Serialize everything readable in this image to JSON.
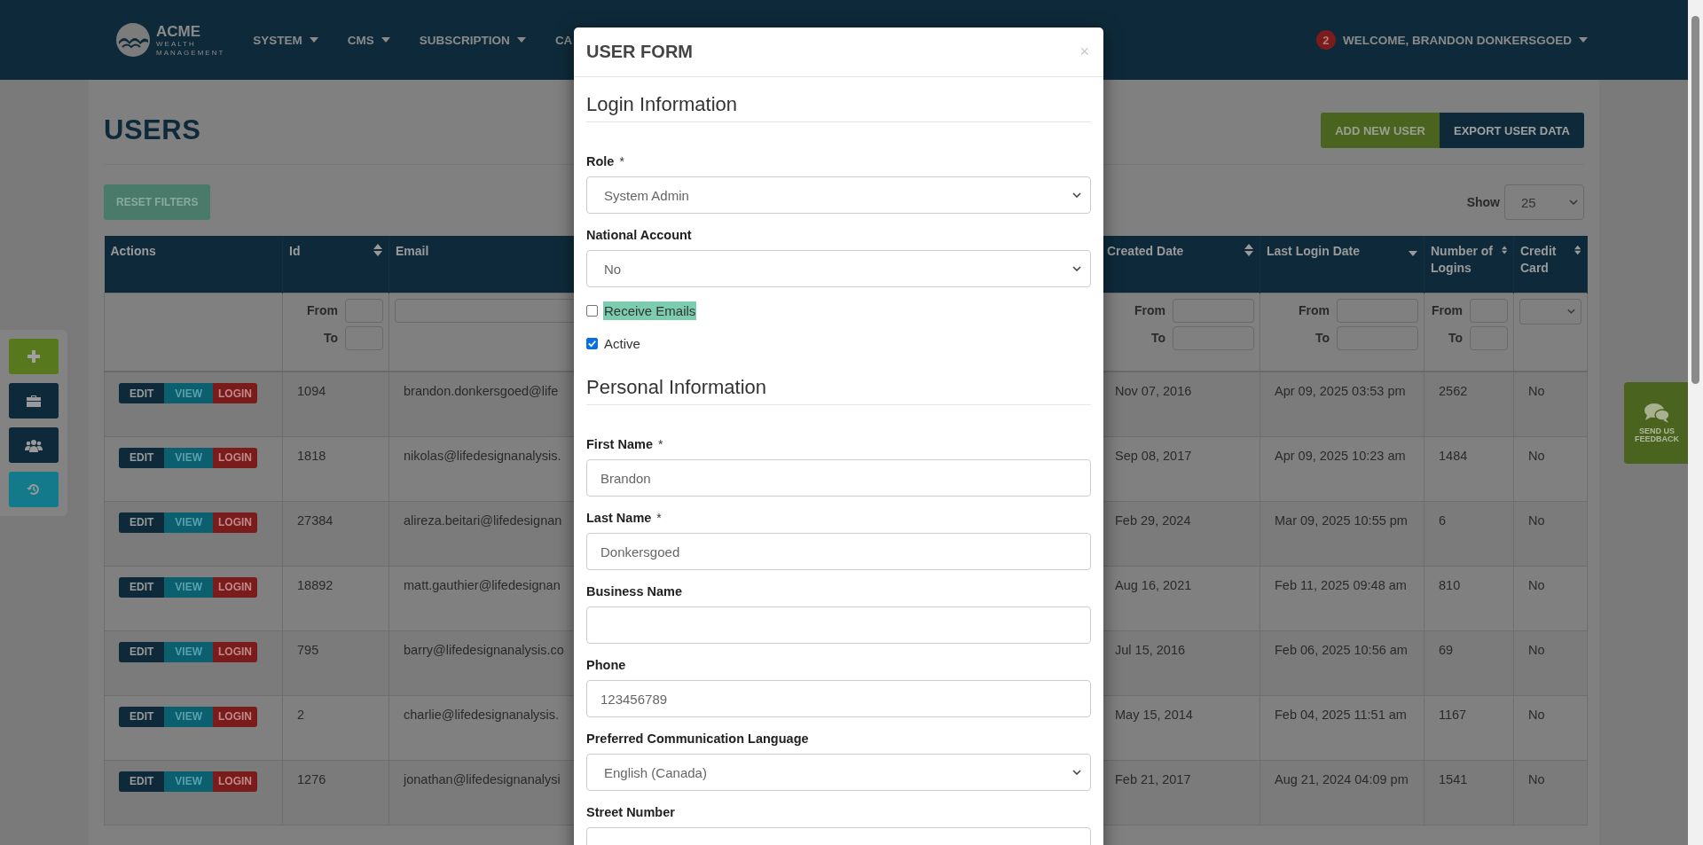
{
  "header": {
    "logo": {
      "name": "ACME",
      "line_1": "WEALTH",
      "line_2": "MANAGEMENT"
    },
    "nav": [
      {
        "label": "SYSTEM",
        "caret": true
      },
      {
        "label": "CMS",
        "caret": true
      },
      {
        "label": "SUBSCRIPTION",
        "caret": true
      },
      {
        "label": "CA",
        "caret": false
      }
    ],
    "notification_count": "2",
    "user_menu": "WELCOME, BRANDON DONKERSGOED"
  },
  "page": {
    "title": "USERS",
    "buttons": [
      {
        "label": "ADD NEW USER",
        "kind": "add"
      },
      {
        "label": "EXPORT USER DATA",
        "kind": "export"
      }
    ],
    "reset_filters": "RESET FILTERS",
    "show_label": "Show",
    "page_size": "25"
  },
  "sidebar": {
    "buttons": [
      {
        "kind": "plus"
      },
      {
        "kind": "briefcase"
      },
      {
        "kind": "users"
      },
      {
        "kind": "history"
      }
    ]
  },
  "feedback": {
    "label": "SEND US FEEDBACK"
  },
  "table": {
    "columns": [
      {
        "label": "Actions",
        "filter": {
          "kind": "none"
        }
      },
      {
        "label": "Id",
        "sortable": true,
        "sorted": false,
        "filter": {
          "kind": "range",
          "from": "From",
          "to": "To"
        }
      },
      {
        "label": "Email",
        "filter": {
          "kind": "text"
        }
      },
      {
        "label": "Created Date",
        "sortable": true,
        "sorted": false,
        "filter": {
          "kind": "range",
          "from": "From",
          "to": "To"
        }
      },
      {
        "label": "Last Login Date",
        "sortable": true,
        "sorted": true,
        "filter": {
          "kind": "range",
          "from": "From",
          "to": "To"
        }
      },
      {
        "label": "Number of Logins",
        "sortable": true,
        "sorted": false,
        "filter": {
          "kind": "range",
          "from": "From",
          "to": "To"
        }
      },
      {
        "label": "Credit Card",
        "sortable": true,
        "sorted": false,
        "filter": {
          "kind": "select"
        }
      }
    ],
    "rows": [
      {
        "cells": [
          {
            "buttons": [
              "EDIT",
              "VIEW",
              "LOGIN"
            ]
          },
          "1094",
          "brandon.donkersgoed@life",
          "Nov 07, 2016",
          "Apr 09, 2025 03:53 pm",
          "2562",
          "No"
        ]
      },
      {
        "cells": [
          {
            "buttons": [
              "EDIT",
              "VIEW",
              "LOGIN"
            ]
          },
          "1818",
          "nikolas@lifedesignanalysis.",
          "Sep 08, 2017",
          "Apr 09, 2025 10:23 am",
          "1484",
          "No"
        ]
      },
      {
        "cells": [
          {
            "buttons": [
              "EDIT",
              "VIEW",
              "LOGIN"
            ]
          },
          "27384",
          "alireza.beitari@lifedesignan",
          "Feb 29, 2024",
          "Mar 09, 2025 10:55 pm",
          "6",
          "No"
        ]
      },
      {
        "cells": [
          {
            "buttons": [
              "EDIT",
              "VIEW",
              "LOGIN"
            ]
          },
          "18892",
          "matt.gauthier@lifedesignan",
          "Aug 16, 2021",
          "Feb 11, 2025 09:48 am",
          "810",
          "No"
        ]
      },
      {
        "cells": [
          {
            "buttons": [
              "EDIT",
              "VIEW",
              "LOGIN"
            ]
          },
          "795",
          "barry@lifedesignanalysis.co",
          "Jul 15, 2016",
          "Feb 06, 2025 10:56 am",
          "69",
          "No"
        ]
      },
      {
        "cells": [
          {
            "buttons": [
              "EDIT",
              "VIEW",
              "LOGIN"
            ]
          },
          "2",
          "charlie@lifedesignanalysis.",
          "May 15, 2014",
          "Feb 04, 2025 11:51 am",
          "1167",
          "No"
        ]
      },
      {
        "cells": [
          {
            "buttons": [
              "EDIT",
              "VIEW",
              "LOGIN"
            ]
          },
          "1276",
          "jonathan@lifedesignanalysi",
          "Feb 21, 2017",
          "Aug 21, 2024 04:09 pm",
          "1541",
          "No"
        ]
      }
    ]
  },
  "modal": {
    "title": "USER FORM",
    "close": "×",
    "sections": [
      {
        "heading": "Login Information",
        "fields": [
          {
            "kind": "select",
            "label": "Role",
            "mark": "*",
            "value": "System Admin"
          },
          {
            "kind": "select",
            "label": "National Account",
            "value": "No"
          },
          {
            "kind": "checkbox",
            "label": "Receive Emails",
            "checked": false,
            "highlighted": true
          },
          {
            "kind": "checkbox",
            "label": "Active",
            "checked": true,
            "highlighted": false
          }
        ]
      },
      {
        "heading": "Personal Information",
        "fields": [
          {
            "kind": "text",
            "label": "First Name",
            "mark": "*",
            "value": "Brandon"
          },
          {
            "kind": "text",
            "label": "Last Name",
            "mark": "*",
            "value": "Donkersgoed"
          },
          {
            "kind": "text",
            "label": "Business Name"
          },
          {
            "kind": "text",
            "label": "Phone",
            "value": "123456789"
          },
          {
            "kind": "select",
            "label": "Preferred Communication Language",
            "value": "English (Canada)"
          },
          {
            "kind": "text",
            "label": "Street Number"
          }
        ]
      }
    ]
  }
}
